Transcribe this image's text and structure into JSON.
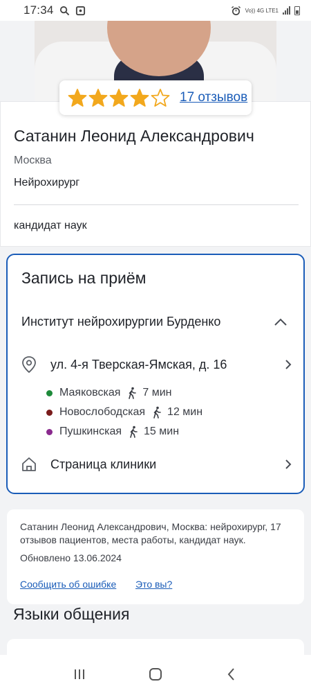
{
  "status_bar": {
    "time": "17:34",
    "network": "Vo)) 4G LTE1",
    "icons": [
      "search-icon",
      "screenshot-icon",
      "alarm-icon",
      "signal-icon",
      "battery-icon"
    ]
  },
  "rating": {
    "stars_filled": 4,
    "stars_total": 5,
    "reviews_link": "17 отзывов",
    "star_color": "#f2a81d"
  },
  "profile": {
    "name": "Сатанин Леонид Александрович",
    "city": "Москва",
    "specialty": "Нейрохирург",
    "degree": "кандидат наук"
  },
  "appointment": {
    "title": "Запись на приём",
    "clinic_name": "Институт нейрохирургии Бурденко",
    "address": "ул. 4-я Тверская-Ямская, д. 16",
    "metro": [
      {
        "station": "Маяковская",
        "time": "7 мин",
        "color": "#1e8a3a"
      },
      {
        "station": "Новослободская",
        "time": "12 мин",
        "color": "#7a1c1c"
      },
      {
        "station": "Пушкинская",
        "time": "15 мин",
        "color": "#8a2a8e"
      }
    ],
    "clinic_page_label": "Страница клиники",
    "accent_color": "#1a5cb8"
  },
  "summary": {
    "description": "Сатанин Леонид Александрович, Москва: нейрохирург, 17 отзывов пациентов, места работы, кандидат наук.",
    "updated": "Обновлено 13.06.2024",
    "report_error_link": "Сообщить об ошибке",
    "is_it_you_link": "Это вы?"
  },
  "languages": {
    "title": "Языки общения"
  },
  "nav_bar": {
    "icons": [
      "recent-apps-icon",
      "home-icon",
      "back-icon"
    ]
  }
}
